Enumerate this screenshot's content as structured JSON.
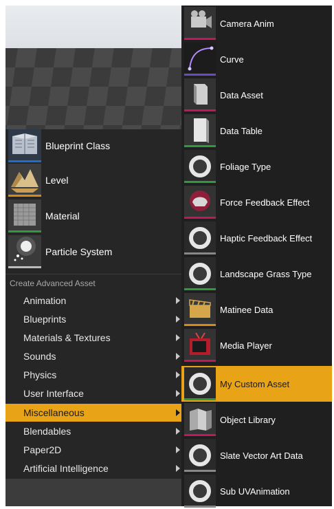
{
  "quick_assets": [
    {
      "label": "Blueprint Class",
      "icon": "blueprint-class-icon",
      "accent": "#1a6fd6"
    },
    {
      "label": "Level",
      "icon": "level-icon",
      "accent": "#d68a1a"
    },
    {
      "label": "Material",
      "icon": "material-icon",
      "accent": "#2e9a3c"
    },
    {
      "label": "Particle System",
      "icon": "particle-system-icon",
      "accent": "#bbbbbb"
    }
  ],
  "advanced": {
    "title": "Create Advanced Asset",
    "categories": [
      {
        "label": "Animation"
      },
      {
        "label": "Blueprints"
      },
      {
        "label": "Materials & Textures"
      },
      {
        "label": "Sounds"
      },
      {
        "label": "Physics"
      },
      {
        "label": "User Interface"
      },
      {
        "label": "Miscellaneous",
        "selected": true
      },
      {
        "label": "Blendables"
      },
      {
        "label": "Paper2D"
      },
      {
        "label": "Artificial Intelligence"
      }
    ]
  },
  "submenu": [
    {
      "label": "Camera Anim",
      "icon": "camera-anim-icon",
      "accent": "#c2185b"
    },
    {
      "label": "Curve",
      "icon": "curve-icon",
      "accent": "#6a4bc4"
    },
    {
      "label": "Data Asset",
      "icon": "data-asset-icon",
      "accent": "#c2185b"
    },
    {
      "label": "Data Table",
      "icon": "data-table-icon",
      "accent": "#2e9a3c"
    },
    {
      "label": "Foliage Type",
      "icon": "foliage-type-icon",
      "accent": "#2e9a3c"
    },
    {
      "label": "Force Feedback Effect",
      "icon": "force-feedback-icon",
      "accent": "#c2185b"
    },
    {
      "label": "Haptic Feedback Effect",
      "icon": "haptic-feedback-icon",
      "accent": "#888888"
    },
    {
      "label": "Landscape Grass Type",
      "icon": "landscape-grass-icon",
      "accent": "#2e9a3c"
    },
    {
      "label": "Matinee Data",
      "icon": "matinee-data-icon",
      "accent": "#d68a1a"
    },
    {
      "label": "Media Player",
      "icon": "media-player-icon",
      "accent": "#c2185b"
    },
    {
      "label": "My Custom Asset",
      "icon": "custom-asset-icon",
      "accent": "#2e9a3c",
      "highlighted": true
    },
    {
      "label": "Object Library",
      "icon": "object-library-icon",
      "accent": "#c2185b"
    },
    {
      "label": "Slate Vector Art Data",
      "icon": "slate-vector-icon",
      "accent": "#888888"
    },
    {
      "label": "Sub UVAnimation",
      "icon": "sub-uv-animation-icon",
      "accent": "#888888"
    }
  ],
  "colors": {
    "selection": "#e8a317",
    "background": "#1f1f1f"
  }
}
